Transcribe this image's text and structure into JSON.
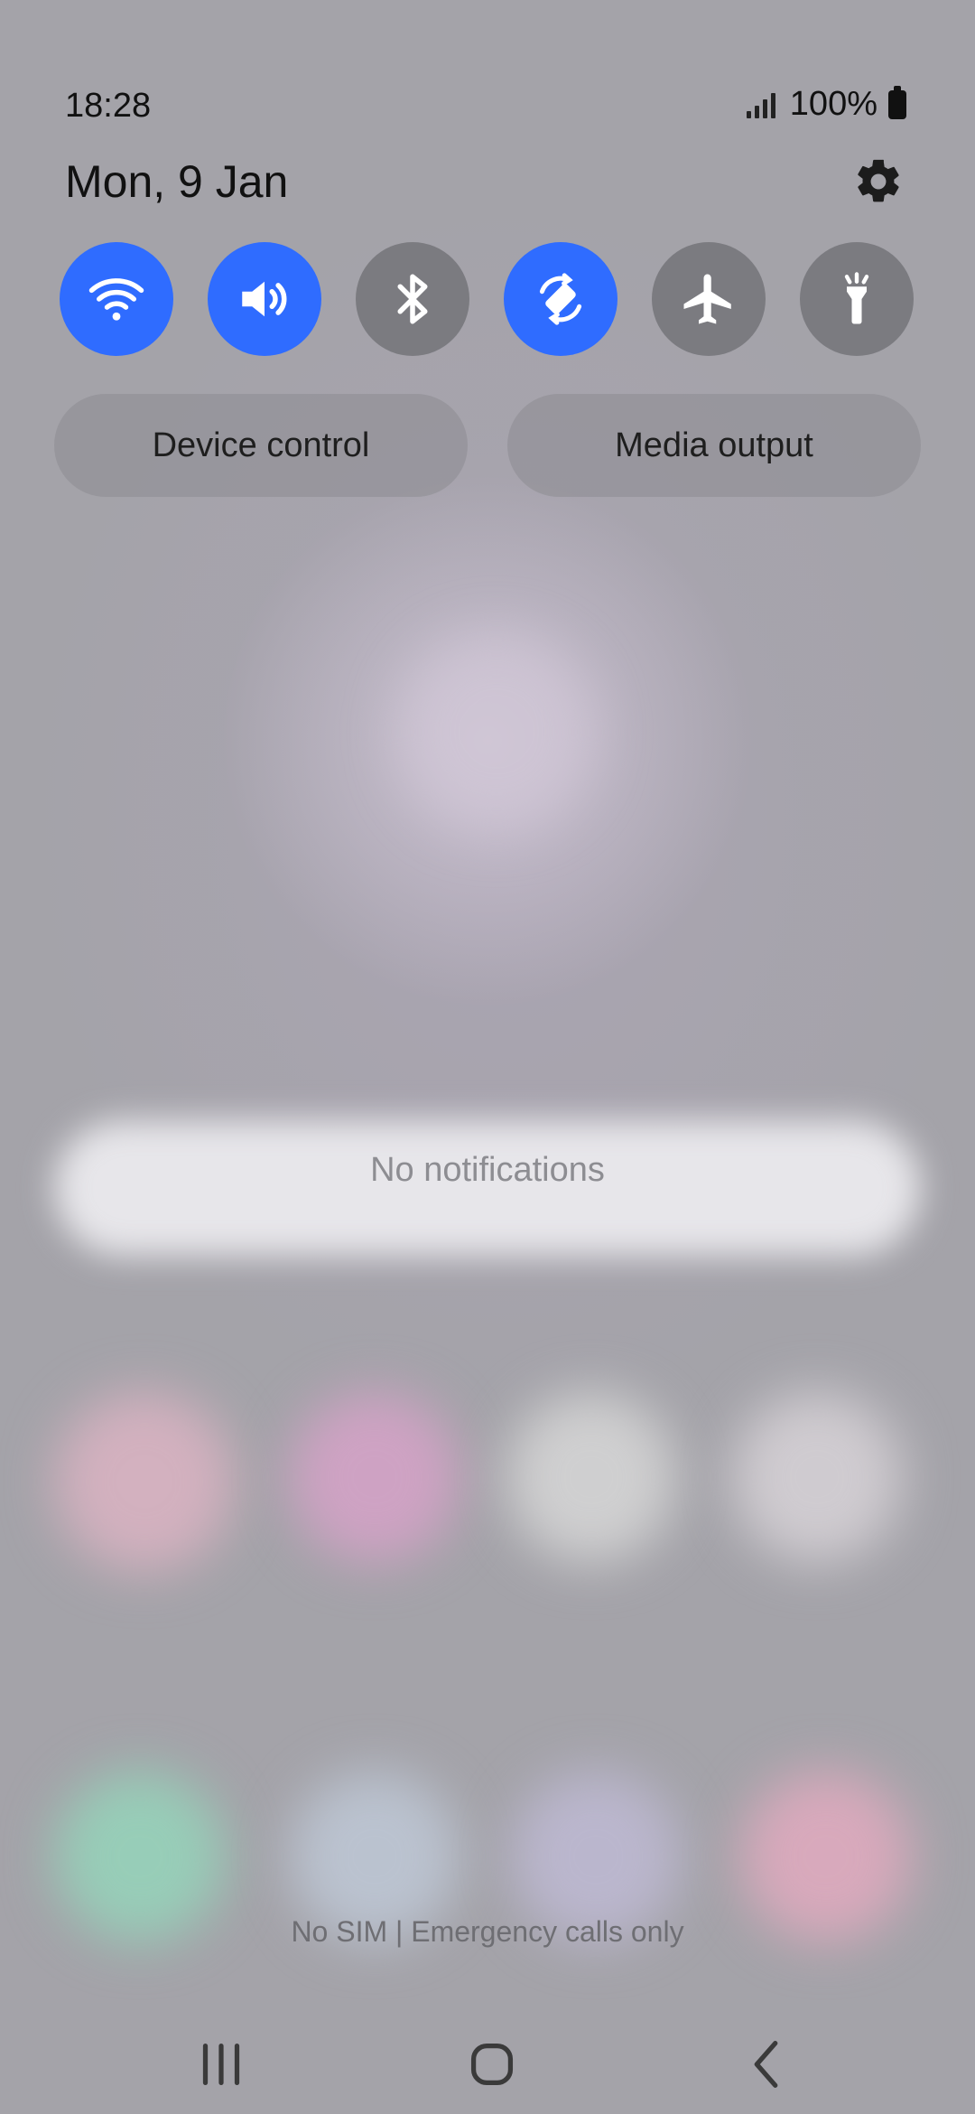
{
  "status_bar": {
    "time": "18:28",
    "battery_percent": "100%",
    "signal_icon": "signal-bars-icon",
    "battery_icon": "battery-full-icon"
  },
  "header": {
    "date": "Mon, 9 Jan",
    "settings_icon": "gear-icon"
  },
  "quick_toggles": [
    {
      "name": "wifi",
      "icon": "wifi-icon",
      "state": "on"
    },
    {
      "name": "sound",
      "icon": "sound-icon",
      "state": "on"
    },
    {
      "name": "bluetooth",
      "icon": "bluetooth-icon",
      "state": "off"
    },
    {
      "name": "auto-rotate",
      "icon": "auto-rotate-icon",
      "state": "on"
    },
    {
      "name": "airplane-mode",
      "icon": "airplane-icon",
      "state": "off"
    },
    {
      "name": "flashlight",
      "icon": "flashlight-icon",
      "state": "off"
    }
  ],
  "buttons": {
    "device_control": "Device control",
    "media_output": "Media output"
  },
  "notifications": {
    "empty_text": "No notifications"
  },
  "carrier_text": "No SIM | Emergency calls only",
  "nav_bar": {
    "recents_icon": "recents-icon",
    "home_icon": "home-icon",
    "back_icon": "back-icon"
  },
  "colors": {
    "toggle_on": "#2f6cff",
    "toggle_off": "#7b7b80"
  }
}
